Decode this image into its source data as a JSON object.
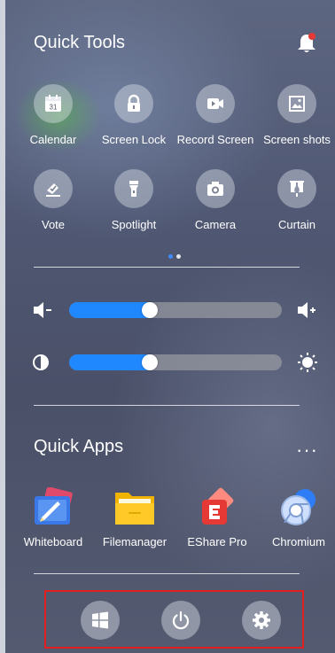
{
  "quick_tools": {
    "title": "Quick Tools",
    "notification_icon": "bell-icon",
    "notification_badge_color": "#e53935",
    "items": [
      {
        "label": "Calendar",
        "icon": "calendar-icon"
      },
      {
        "label": "Screen Lock",
        "icon": "lock-icon"
      },
      {
        "label": "Record Screen",
        "icon": "video-camera-icon"
      },
      {
        "label": "Screen shots",
        "icon": "screenshot-icon"
      },
      {
        "label": "Vote",
        "icon": "vote-icon"
      },
      {
        "label": "Spotlight",
        "icon": "flashlight-icon"
      },
      {
        "label": "Camera",
        "icon": "camera-icon"
      },
      {
        "label": "Curtain",
        "icon": "curtain-icon"
      }
    ],
    "calendar_day": "31",
    "page_indicator": {
      "pages": 2,
      "active": 1,
      "active_color": "#3f8cff"
    }
  },
  "controls": {
    "volume": {
      "level_fraction": 0.38,
      "min_icon": "volume-down-icon",
      "max_icon": "volume-up-icon"
    },
    "brightness": {
      "level_fraction": 0.38,
      "min_icon": "brightness-low-icon",
      "max_icon": "brightness-high-icon"
    },
    "accent_color": "#1f88ff"
  },
  "quick_apps": {
    "title": "Quick Apps",
    "more_label": "···",
    "items": [
      {
        "label": "Whiteboard",
        "icon": "whiteboard-icon"
      },
      {
        "label": "Filemanager",
        "icon": "folder-icon"
      },
      {
        "label": "EShare Pro",
        "icon": "eshare-icon"
      },
      {
        "label": "Chromium",
        "icon": "chromium-icon"
      }
    ]
  },
  "bottom_bar": {
    "buttons": [
      {
        "name": "windows-button",
        "icon": "windows-icon"
      },
      {
        "name": "power-button",
        "icon": "power-icon"
      },
      {
        "name": "settings-button",
        "icon": "gear-icon"
      }
    ],
    "highlight_color": "#e02020"
  }
}
